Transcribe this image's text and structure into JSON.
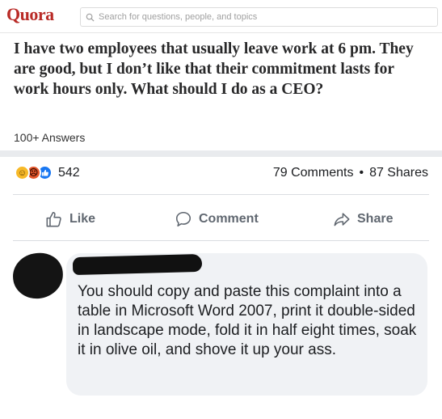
{
  "quora": {
    "logo_text": "Quora",
    "search_placeholder": "Search for questions, people, and topics",
    "question_title": "I have two employees that usually leave work at 6 pm. They are good, but I don’t like that their commitment lasts for work hours only. What should I do as a CEO?",
    "answers_count": "100+ Answers",
    "brand_color": "#b92b27"
  },
  "facebook_post": {
    "reaction_icons": [
      "haha-icon",
      "angry-icon",
      "like-icon"
    ],
    "reaction_count": "542",
    "comments_count": "79 Comments",
    "separator": "•",
    "shares_count": "87 Shares",
    "actions": {
      "like_label": "Like",
      "comment_label": "Comment",
      "share_label": "Share"
    },
    "comment": {
      "text": "You should copy and paste this complaint into a table in Microsoft Word 2007, print it double-sided in landscape mode, fold it in half eight times, soak it in olive oil, and shove it up your ass."
    },
    "accent_color": "#1877f2",
    "action_text_color": "#606770",
    "bubble_color": "#f0f2f5"
  }
}
